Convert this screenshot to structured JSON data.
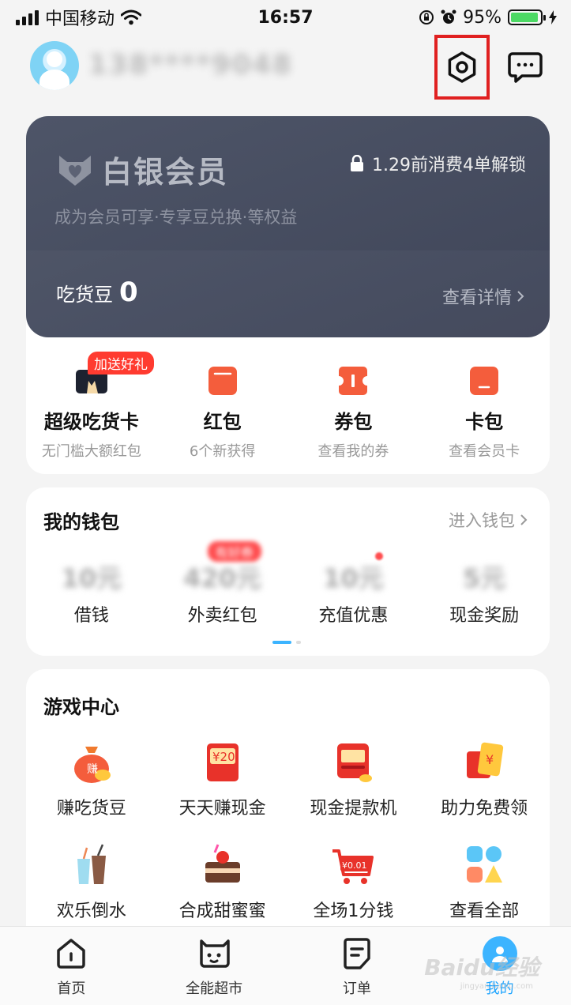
{
  "status_bar": {
    "carrier": "中国移动",
    "time": "16:57",
    "battery": "95%",
    "battery_level": 0.95
  },
  "header": {
    "username": "138****9048",
    "settings_icon": "settings-icon",
    "message_icon": "message-icon"
  },
  "member": {
    "title": "白银会员",
    "unlock_text": "1.29前消费4单解锁",
    "subtitle": "成为会员可享·专享豆兑换·等权益",
    "beans_label": "吃货豆",
    "beans_value": "0",
    "detail_link": "查看详情"
  },
  "quick": [
    {
      "title": "超级吃货卡",
      "sub": "无门槛大额红包",
      "tag": "加送好礼"
    },
    {
      "title": "红包",
      "sub": "6个新获得"
    },
    {
      "title": "券包",
      "sub": "查看我的券"
    },
    {
      "title": "卡包",
      "sub": "查看会员卡"
    }
  ],
  "wallet": {
    "title": "我的钱包",
    "link": "进入钱包",
    "tag": "有好券",
    "items": [
      {
        "value": "10元",
        "label": "借钱"
      },
      {
        "value": "420元",
        "label": "外卖红包"
      },
      {
        "value": "10元",
        "label": "充值优惠"
      },
      {
        "value": "5元",
        "label": "现金奖励"
      }
    ]
  },
  "games": {
    "title": "游戏中心",
    "items": [
      {
        "label": "赚吃货豆",
        "icon": "money-bag-icon",
        "icon_text": "赚"
      },
      {
        "label": "天天赚现金",
        "icon": "red-envelope-icon",
        "icon_text": "¥20"
      },
      {
        "label": "现金提款机",
        "icon": "cash-machine-icon"
      },
      {
        "label": "助力免费领",
        "icon": "coupon-icon",
        "icon_text": "¥"
      },
      {
        "label": "欢乐倒水",
        "icon": "drink-cups-icon"
      },
      {
        "label": "合成甜蜜蜜",
        "icon": "cake-icon"
      },
      {
        "label": "全场1分钱",
        "icon": "shopping-cart-icon",
        "icon_text": "¥0.01"
      },
      {
        "label": "查看全部",
        "icon": "all-apps-icon"
      }
    ]
  },
  "tabs": [
    {
      "label": "首页",
      "icon": "home-icon"
    },
    {
      "label": "全能超市",
      "icon": "supermarket-icon"
    },
    {
      "label": "订单",
      "icon": "order-icon"
    },
    {
      "label": "我的",
      "icon": "profile-icon",
      "active": true
    }
  ],
  "watermark": {
    "text": "Baidu经验",
    "sub": "jingyan.baidu.com"
  },
  "colors": {
    "accent": "#1aa3ff",
    "member_card": "#464c5e",
    "orange": "#f45d3c",
    "highlight_box": "#e02020"
  }
}
